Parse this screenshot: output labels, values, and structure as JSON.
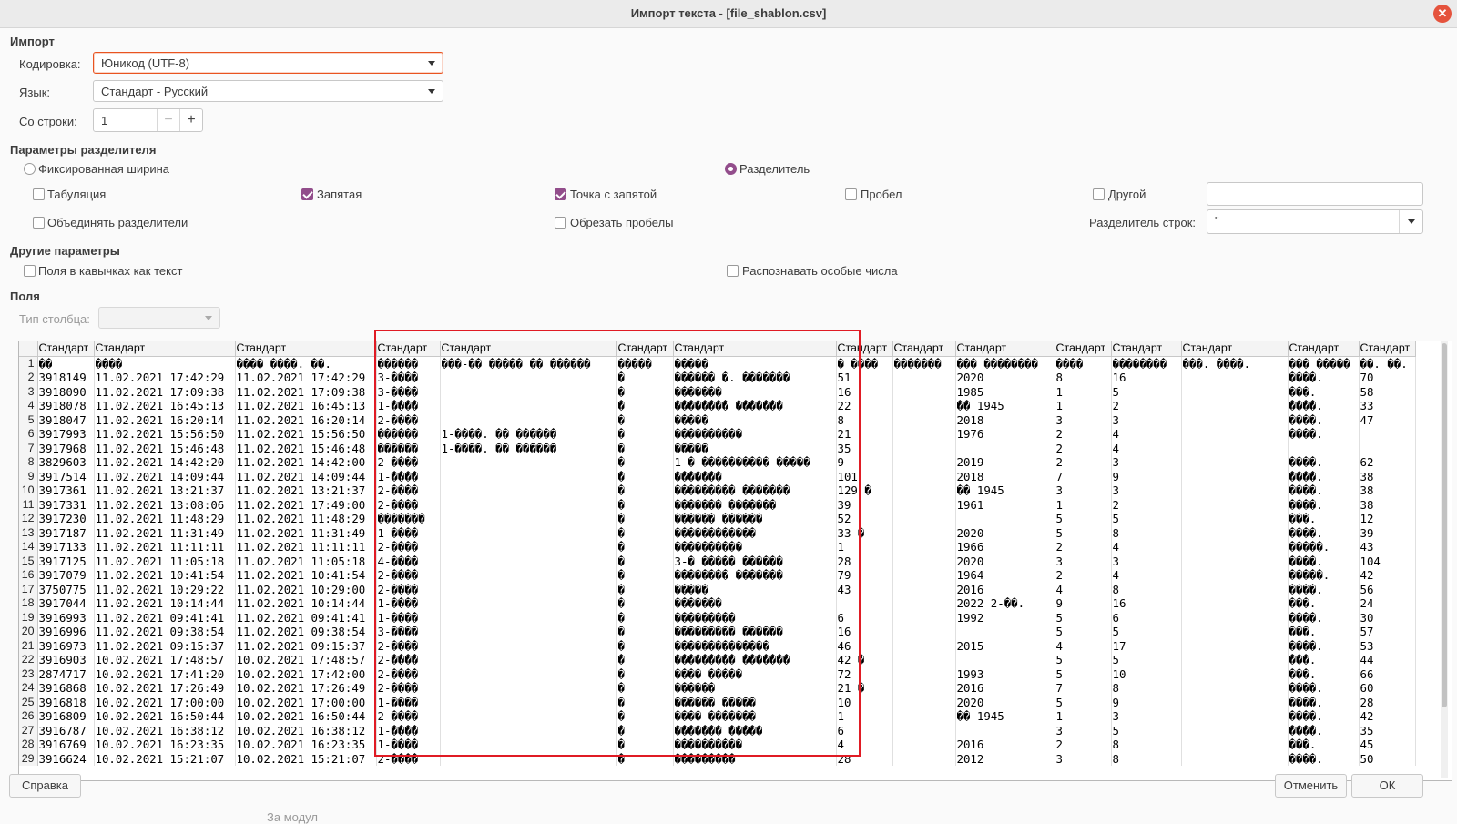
{
  "window": {
    "title": "Импорт текста - [file_shablon.csv]"
  },
  "import_section": {
    "heading": "Импорт",
    "encoding_label": "Кодировка:",
    "encoding_value": "Юникод (UTF-8)",
    "language_label": "Язык:",
    "language_value": "Стандарт - Русский",
    "from_row_label": "Со строки:",
    "from_row_value": "1",
    "minus_glyph": "−",
    "plus_glyph": "+"
  },
  "separator_section": {
    "heading": "Параметры разделителя",
    "fixed_width_label": "Фиксированная ширина",
    "fixed_width_checked": false,
    "separated_label": "Разделитель",
    "separated_checked": true,
    "tab_label": "Табуляция",
    "tab_checked": false,
    "comma_label": "Запятая",
    "comma_checked": true,
    "semicolon_label": "Точка с запятой",
    "semicolon_checked": true,
    "space_label": "Пробел",
    "space_checked": false,
    "other_label": "Другой",
    "other_checked": false,
    "other_value": "",
    "merge_label": "Объединять разделители",
    "merge_checked": false,
    "trim_label": "Обрезать пробелы",
    "trim_checked": false,
    "string_delim_label": "Разделитель строк:",
    "string_delim_value": "\""
  },
  "other_section": {
    "heading": "Другие параметры",
    "quoted_as_text_label": "Поля в кавычках как текст",
    "quoted_as_text_checked": false,
    "detect_special_label": "Распознавать особые числа",
    "detect_special_checked": false
  },
  "fields_section": {
    "heading": "Поля",
    "column_type_label": "Тип столбца:",
    "column_type_value": ""
  },
  "grid": {
    "headers": [
      "Стандарт",
      "Стандарт",
      "Стандарт",
      "Стандарт",
      "Стандарт",
      "Стандарт",
      "Стандарт",
      "Стандарт",
      "Стандарт",
      "Стандарт",
      "Стандарт",
      "Стандарт",
      "Стандарт",
      "Стандарт",
      "Стандарт"
    ],
    "rows": [
      [
        "1",
        "��",
        "����",
        "���� ����. ��.",
        "������",
        "���-�� ����� �� ������",
        "�����",
        "�����",
        "� ����",
        "�������",
        "��� ��������",
        "����",
        "��������",
        "���. ����.",
        "��� �����",
        "��. ��."
      ],
      [
        "2",
        "3918149",
        "11.02.2021 17:42:29",
        "11.02.2021 17:42:29",
        "3-����",
        "",
        "�",
        "������ �. �������",
        "51",
        "",
        "2020",
        "8",
        "16",
        "",
        "����.",
        "70"
      ],
      [
        "3",
        "3918090",
        "11.02.2021 17:09:38",
        "11.02.2021 17:09:38",
        "3-����",
        "",
        "�",
        "�������",
        "16",
        "",
        "1985",
        "1",
        "5",
        "",
        "���.",
        "58"
      ],
      [
        "4",
        "3918078",
        "11.02.2021 16:45:13",
        "11.02.2021 16:45:13",
        "1-����",
        "",
        "�",
        "�������� �������",
        "22",
        "",
        "�� 1945",
        "1",
        "2",
        "",
        "����.",
        "33"
      ],
      [
        "5",
        "3918047",
        "11.02.2021 16:20:14",
        "11.02.2021 16:20:14",
        "2-����",
        "",
        "�",
        "�����",
        "8",
        "",
        "2018",
        "3",
        "3",
        "",
        "����.",
        "47"
      ],
      [
        "6",
        "3917993",
        "11.02.2021 15:56:50",
        "11.02.2021 15:56:50",
        "������",
        "1-����. �� ������",
        "�",
        "����������",
        "21",
        "",
        "1976",
        "2",
        "4",
        "",
        "����.",
        ""
      ],
      [
        "7",
        "3917968",
        "11.02.2021 15:46:48",
        "11.02.2021 15:46:48",
        "������",
        "1-����. �� ������",
        "�",
        "�����",
        "35",
        "",
        "",
        "2",
        "4",
        "",
        "",
        ""
      ],
      [
        "8",
        "3829603",
        "11.02.2021 14:42:20",
        "11.02.2021 14:42:00",
        "2-����",
        "",
        "�",
        "1-� ���������� �����",
        "9",
        "",
        "2019",
        "2",
        "3",
        "",
        "����.",
        "62"
      ],
      [
        "9",
        "3917514",
        "11.02.2021 14:09:44",
        "11.02.2021 14:09:44",
        "1-����",
        "",
        "�",
        "�������",
        "101",
        "",
        "2018",
        "7",
        "9",
        "",
        "����.",
        "38"
      ],
      [
        "10",
        "3917361",
        "11.02.2021 13:21:37",
        "11.02.2021 13:21:37",
        "2-����",
        "",
        "�",
        "��������� �������",
        "129 �",
        "",
        "�� 1945",
        "3",
        "3",
        "",
        "����.",
        "38"
      ],
      [
        "11",
        "3917331",
        "11.02.2021 13:08:06",
        "11.02.2021 17:49:00",
        "2-����",
        "",
        "�",
        "������� �������",
        "39",
        "",
        "1961",
        "1",
        "2",
        "",
        "����.",
        "38"
      ],
      [
        "12",
        "3917230",
        "11.02.2021 11:48:29",
        "11.02.2021 11:48:29",
        "�������",
        "",
        "�",
        "������ ������",
        "52",
        "",
        "",
        "5",
        "5",
        "",
        "���.",
        "12"
      ],
      [
        "13",
        "3917187",
        "11.02.2021 11:31:49",
        "11.02.2021 11:31:49",
        "1-����",
        "",
        "�",
        "������������",
        "33 �",
        "",
        "2020",
        "5",
        "8",
        "",
        "����.",
        "39"
      ],
      [
        "14",
        "3917133",
        "11.02.2021 11:11:11",
        "11.02.2021 11:11:11",
        "2-����",
        "",
        "�",
        "����������",
        "1",
        "",
        "1966",
        "2",
        "4",
        "",
        "�����.",
        "43"
      ],
      [
        "15",
        "3917125",
        "11.02.2021 11:05:18",
        "11.02.2021 11:05:18",
        "4-����",
        "",
        "�",
        "3-� ����� ������",
        "28",
        "",
        "2020",
        "3",
        "3",
        "",
        "����.",
        "104"
      ],
      [
        "16",
        "3917079",
        "11.02.2021 10:41:54",
        "11.02.2021 10:41:54",
        "2-����",
        "",
        "�",
        "�������� �������",
        "79",
        "",
        "1964",
        "2",
        "4",
        "",
        "�����.",
        "42"
      ],
      [
        "17",
        "3750775",
        "11.02.2021 10:29:22",
        "11.02.2021 10:29:00",
        "2-����",
        "",
        "�",
        "�����",
        "43",
        "",
        "2016",
        "4",
        "8",
        "",
        "����.",
        "56"
      ],
      [
        "18",
        "3917044",
        "11.02.2021 10:14:44",
        "11.02.2021 10:14:44",
        "1-����",
        "",
        "�",
        "�������",
        "",
        "",
        "2022 2-��.",
        "9",
        "16",
        "",
        "���.",
        "24"
      ],
      [
        "19",
        "3916993",
        "11.02.2021 09:41:41",
        "11.02.2021 09:41:41",
        "1-����",
        "",
        "�",
        "���������",
        "6",
        "",
        "1992",
        "5",
        "6",
        "",
        "����.",
        "30"
      ],
      [
        "20",
        "3916996",
        "11.02.2021 09:38:54",
        "11.02.2021 09:38:54",
        "3-����",
        "",
        "�",
        "��������� ������",
        "16",
        "",
        "",
        "5",
        "5",
        "",
        "���.",
        "57"
      ],
      [
        "21",
        "3916973",
        "11.02.2021 09:15:37",
        "11.02.2021 09:15:37",
        "2-����",
        "",
        "�",
        "��������������",
        "46",
        "",
        "2015",
        "4",
        "17",
        "",
        "����.",
        "53"
      ],
      [
        "22",
        "3916903",
        "10.02.2021 17:48:57",
        "10.02.2021 17:48:57",
        "2-����",
        "",
        "�",
        "��������� �������",
        "42 �",
        "",
        "",
        "5",
        "5",
        "",
        "���.",
        "44"
      ],
      [
        "23",
        "2874717",
        "10.02.2021 17:41:20",
        "10.02.2021 17:42:00",
        "2-����",
        "",
        "�",
        "���� �����",
        "72",
        "",
        "1993",
        "5",
        "10",
        "",
        "���.",
        "66"
      ],
      [
        "24",
        "3916868",
        "10.02.2021 17:26:49",
        "10.02.2021 17:26:49",
        "2-����",
        "",
        "�",
        "������",
        "21 �",
        "",
        "2016",
        "7",
        "8",
        "",
        "����.",
        "60"
      ],
      [
        "25",
        "3916818",
        "10.02.2021 17:00:00",
        "10.02.2021 17:00:00",
        "1-����",
        "",
        "�",
        "������ �����",
        "10",
        "",
        "2020",
        "5",
        "9",
        "",
        "����.",
        "28"
      ],
      [
        "26",
        "3916809",
        "10.02.2021 16:50:44",
        "10.02.2021 16:50:44",
        "2-����",
        "",
        "�",
        "���� �������",
        "1",
        "",
        "�� 1945",
        "1",
        "3",
        "",
        "����.",
        "42"
      ],
      [
        "27",
        "3916787",
        "10.02.2021 16:38:12",
        "10.02.2021 16:38:12",
        "1-����",
        "",
        "�",
        "������� �����",
        "6",
        "",
        "",
        "3",
        "5",
        "",
        "����.",
        "35"
      ],
      [
        "28",
        "3916769",
        "10.02.2021 16:23:35",
        "10.02.2021 16:23:35",
        "1-����",
        "",
        "�",
        "����������",
        "4",
        "",
        "2016",
        "2",
        "8",
        "",
        "���.",
        "45"
      ],
      [
        "29",
        "3916624",
        "10.02.2021 15:21:07",
        "10.02.2021 15:21:07",
        "2-����",
        "",
        "�",
        "���������",
        "28",
        "",
        "2012",
        "3",
        "8",
        "",
        "����.",
        "50"
      ]
    ]
  },
  "buttons": {
    "help": "Справка",
    "cancel": "Отменить",
    "ok": "ОК"
  },
  "footer_partial_text": "За модул",
  "colors": {
    "accent": "#924d8b",
    "focus": "#e95420",
    "highlight_box": "#e01b24",
    "close": "#e5533d"
  },
  "icons": [
    "close-icon",
    "chevron-down-icon",
    "minus-icon",
    "plus-icon"
  ]
}
